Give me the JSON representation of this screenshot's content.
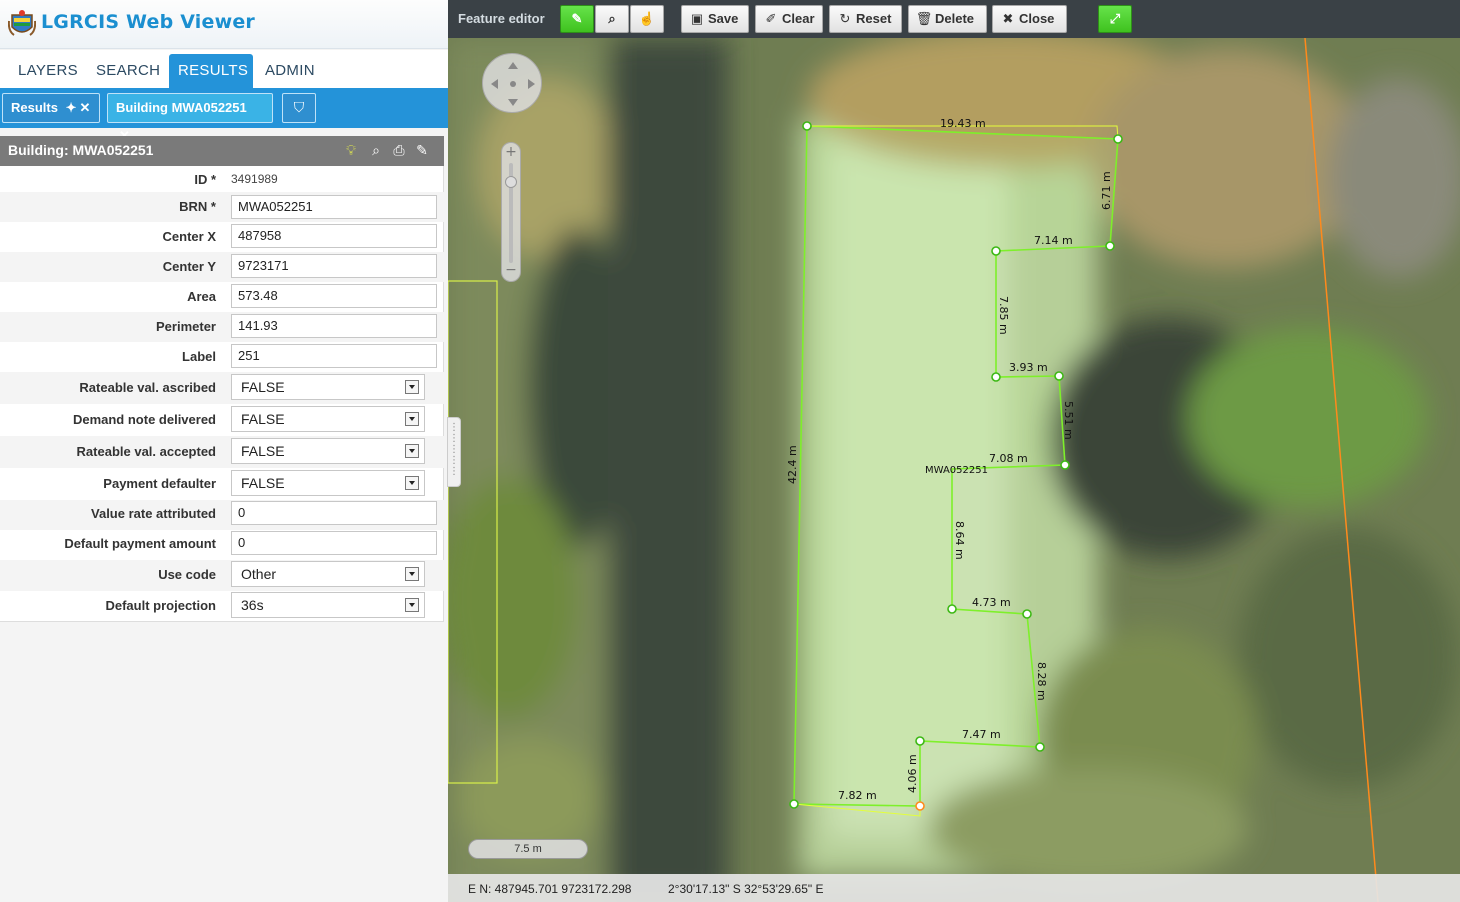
{
  "app": {
    "title": "LGRCIS Web Viewer"
  },
  "main_tabs": [
    {
      "label": "LAYERS",
      "active": false
    },
    {
      "label": "SEARCH",
      "active": false
    },
    {
      "label": "RESULTS",
      "active": true
    },
    {
      "label": "ADMIN",
      "active": false
    }
  ],
  "sub_tabs": [
    {
      "label": "Results",
      "icons": [
        "pin-icon",
        "close-icon"
      ]
    },
    {
      "label": "Building MWA052251",
      "icons": [
        "close-icon"
      ]
    }
  ],
  "panel": {
    "title": "Building: MWA052251",
    "icons": [
      "bulb-icon",
      "zoom-icon",
      "print-icon",
      "edit-icon"
    ]
  },
  "form": {
    "id_label": "ID *",
    "id_value": "3491989",
    "brn_label": "BRN *",
    "brn_value": "MWA052251",
    "cx_label": "Center X",
    "cx_value": "487958",
    "cy_label": "Center Y",
    "cy_value": "9723171",
    "area_label": "Area",
    "area_value": "573.48",
    "perim_label": "Perimeter",
    "perim_value": "141.93",
    "label_label": "Label",
    "label_value": "251",
    "rva_label": "Rateable val. ascribed",
    "rva_value": "FALSE",
    "dnd_label": "Demand note delivered",
    "dnd_value": "FALSE",
    "rvacc_label": "Rateable val. accepted",
    "rvacc_value": "FALSE",
    "pd_label": "Payment defaulter",
    "pd_value": "FALSE",
    "vra_label": "Value rate attributed",
    "vra_value": "0",
    "dpa_label": "Default payment amount",
    "dpa_value": "0",
    "uc_label": "Use code",
    "uc_value": "Other",
    "dp_label": "Default projection",
    "dp_value": "36s"
  },
  "toolbar": {
    "title": "Feature editor",
    "tools": [
      "pencil-icon",
      "magnifier-icon",
      "pointer-info-icon"
    ],
    "save": "Save",
    "clear": "Clear",
    "reset": "Reset",
    "delete": "Delete",
    "close": "Close"
  },
  "map": {
    "feature_label": "MWA052251",
    "segment_labels": {
      "s1": "19.43 m",
      "s2": "6.71 m",
      "s3": "7.14 m",
      "s4": "7.85 m",
      "s5": "3.93 m",
      "s6": "5.51 m",
      "s7": "7.08 m",
      "s8": "8.64 m",
      "s9": "4.73 m",
      "s10": "8.28 m",
      "s11": "7.47 m",
      "s12": "4.06 m",
      "s13": "7.82 m",
      "s14": "42.4 m"
    },
    "scale": "7.5 m",
    "status_en": "E N: 487945.701 9723172.298",
    "status_dms": "2°30'17.13\" S 32°53'29.65\" E",
    "outline_color": "#7ef02a",
    "boundary_color": "#ff8a1c"
  }
}
